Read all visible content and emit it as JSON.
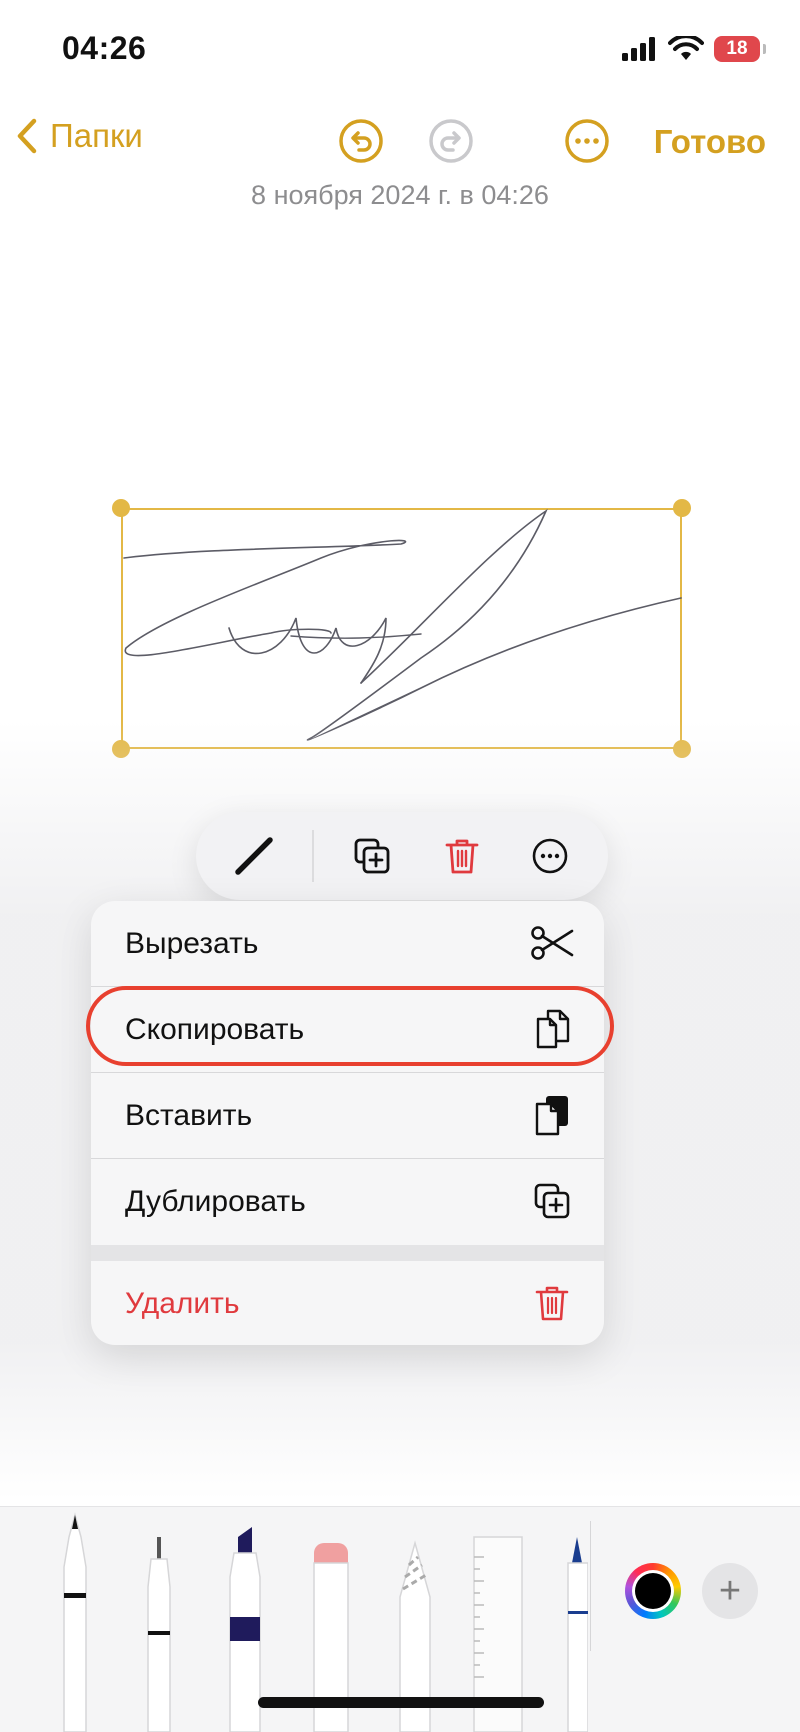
{
  "status_bar": {
    "time": "04:26",
    "battery": "18"
  },
  "nav": {
    "back_label": "Папки",
    "done_label": "Готово"
  },
  "note": {
    "date": "8 ноября 2024 г. в 04:26"
  },
  "context_menu": {
    "items": [
      {
        "label": "Вырезать",
        "icon": "scissors-icon"
      },
      {
        "label": "Скопировать",
        "icon": "copy-icon",
        "highlighted": true
      },
      {
        "label": "Вставить",
        "icon": "paste-icon"
      },
      {
        "label": "Дублировать",
        "icon": "duplicate-icon"
      },
      {
        "label": "Удалить",
        "icon": "trash-icon",
        "destructive": true
      }
    ]
  },
  "colors": {
    "accent": "#d4a020",
    "selection": "#e3b846",
    "destructive": "#e03a3e",
    "highlight_ring": "#e8402f"
  }
}
